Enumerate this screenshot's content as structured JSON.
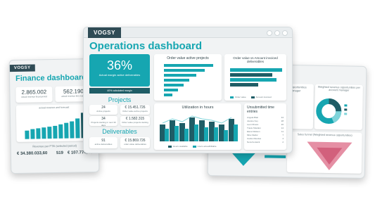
{
  "finance": {
    "logo": "VOGSY",
    "title": "Finance dashboard",
    "kpi1_value": "2.865.002",
    "kpi1_label": "actual revenue fiscal period",
    "kpi2_value": "562.190",
    "kpi2_label": "actual revenue this month",
    "chart_title": "actual revenue and forecast",
    "bottom_title": "Revenue per PTE (selected period)",
    "amount1": "€ 34.380.033,60",
    "count": "519",
    "amount2": "€ 107.774,44"
  },
  "operations": {
    "logo": "VOGSY",
    "title": "Operations dashboard",
    "margin_value": "36%",
    "margin_label": "Actual margin active deliverables",
    "margin_sub": "40% calculated margin",
    "projects_title": "Projects",
    "projects": [
      {
        "value": "24",
        "label": "Active projects"
      },
      {
        "value": "€ 15.451.726",
        "label": "Order value active projects"
      },
      {
        "value": "34",
        "label": "Projects starting in next 30 days"
      },
      {
        "value": "€ 1.582.315",
        "label": "Order value projects starting"
      }
    ],
    "deliverables_title": "Deliverables",
    "deliverables": [
      {
        "value": "91",
        "label": "active deliverables"
      },
      {
        "value": "€ 15.869.726",
        "label": "order value deliverables"
      }
    ],
    "order_value_title": "Order value active projects",
    "order_vs_invoiced_title": "Order value vs Amount invoiced deliverables",
    "legend_order": "Order value",
    "legend_invoiced": "Amount invoiced",
    "utilization_title": "Utilization in hours",
    "util_legend_a": "Hours available",
    "util_legend_b": "Hours actual/billable",
    "unsubmitted_title": "Unsubmitted time entries",
    "unsubmitted": [
      {
        "name": "Angela Blair",
        "count": "34"
      },
      {
        "name": "Joanne Key",
        "count": "28"
      },
      {
        "name": "Leon Rivera",
        "count": "20"
      },
      {
        "name": "Travis Sheldon",
        "count": "14"
      },
      {
        "name": "Elena Watson",
        "count": "11"
      },
      {
        "name": "Mira Okafor",
        "count": "7"
      },
      {
        "name": "Carlos Mendes",
        "count": "4"
      },
      {
        "name": "Nora Fenwick",
        "count": "2"
      }
    ]
  },
  "right": {
    "opportunities_title": "Opportunities manager",
    "weighted_title": "Weighted revenue opportunities per account manager",
    "funnel_title": "Sales funnel (Weighted revenue opportunities)"
  },
  "colors": {
    "teal": "#16a6b1",
    "dark_teal": "#1f5d66",
    "navy": "#2f4b55"
  }
}
